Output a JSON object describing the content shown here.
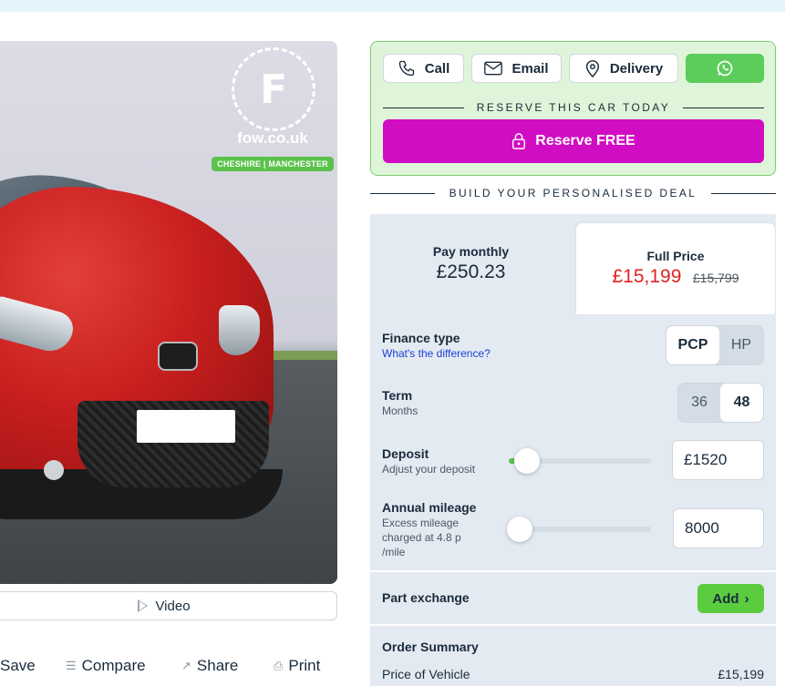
{
  "gallery": {
    "logo_letter": "F",
    "logo_site": "fow.co.uk",
    "logo_locations": "CHESHIRE | MANCHESTER",
    "video_label": "Video"
  },
  "actions": {
    "save": "Save",
    "compare": "Compare",
    "share": "Share",
    "print": "Print"
  },
  "contact": {
    "call": "Call",
    "email": "Email",
    "delivery": "Delivery",
    "reserve_heading": "RESERVE THIS CAR TODAY",
    "reserve_button": "Reserve FREE"
  },
  "deal": {
    "heading": "BUILD YOUR PERSONALISED DEAL",
    "monthly": {
      "label": "Pay monthly",
      "price": "£250.23"
    },
    "full": {
      "label": "Full Price",
      "price": "£15,199",
      "old_price": "£15,799"
    },
    "finance_type": {
      "title": "Finance type",
      "link": "What's the difference?",
      "options": [
        "PCP",
        "HP"
      ],
      "selected": "PCP"
    },
    "term": {
      "title": "Term",
      "sub": "Months",
      "options": [
        "36",
        "48"
      ],
      "selected": "48"
    },
    "deposit": {
      "title": "Deposit",
      "sub": "Adjust your deposit",
      "value": "£1520",
      "slider_fraction": 0.05
    },
    "mileage": {
      "title": "Annual mileage",
      "sub": "Excess mileage charged at 4.8 p /mile",
      "value": "8000",
      "slider_fraction": 0.0
    },
    "part_exchange": {
      "title": "Part exchange",
      "button": "Add"
    },
    "order_summary": {
      "title": "Order Summary",
      "rows": [
        {
          "label": "Price of Vehicle",
          "value": "£15,199"
        }
      ]
    }
  },
  "colors": {
    "reserve": "#d10dc3",
    "whatsapp": "#5ccc5a",
    "price_red": "#e0231f",
    "accent_green": "#5bc24b"
  }
}
